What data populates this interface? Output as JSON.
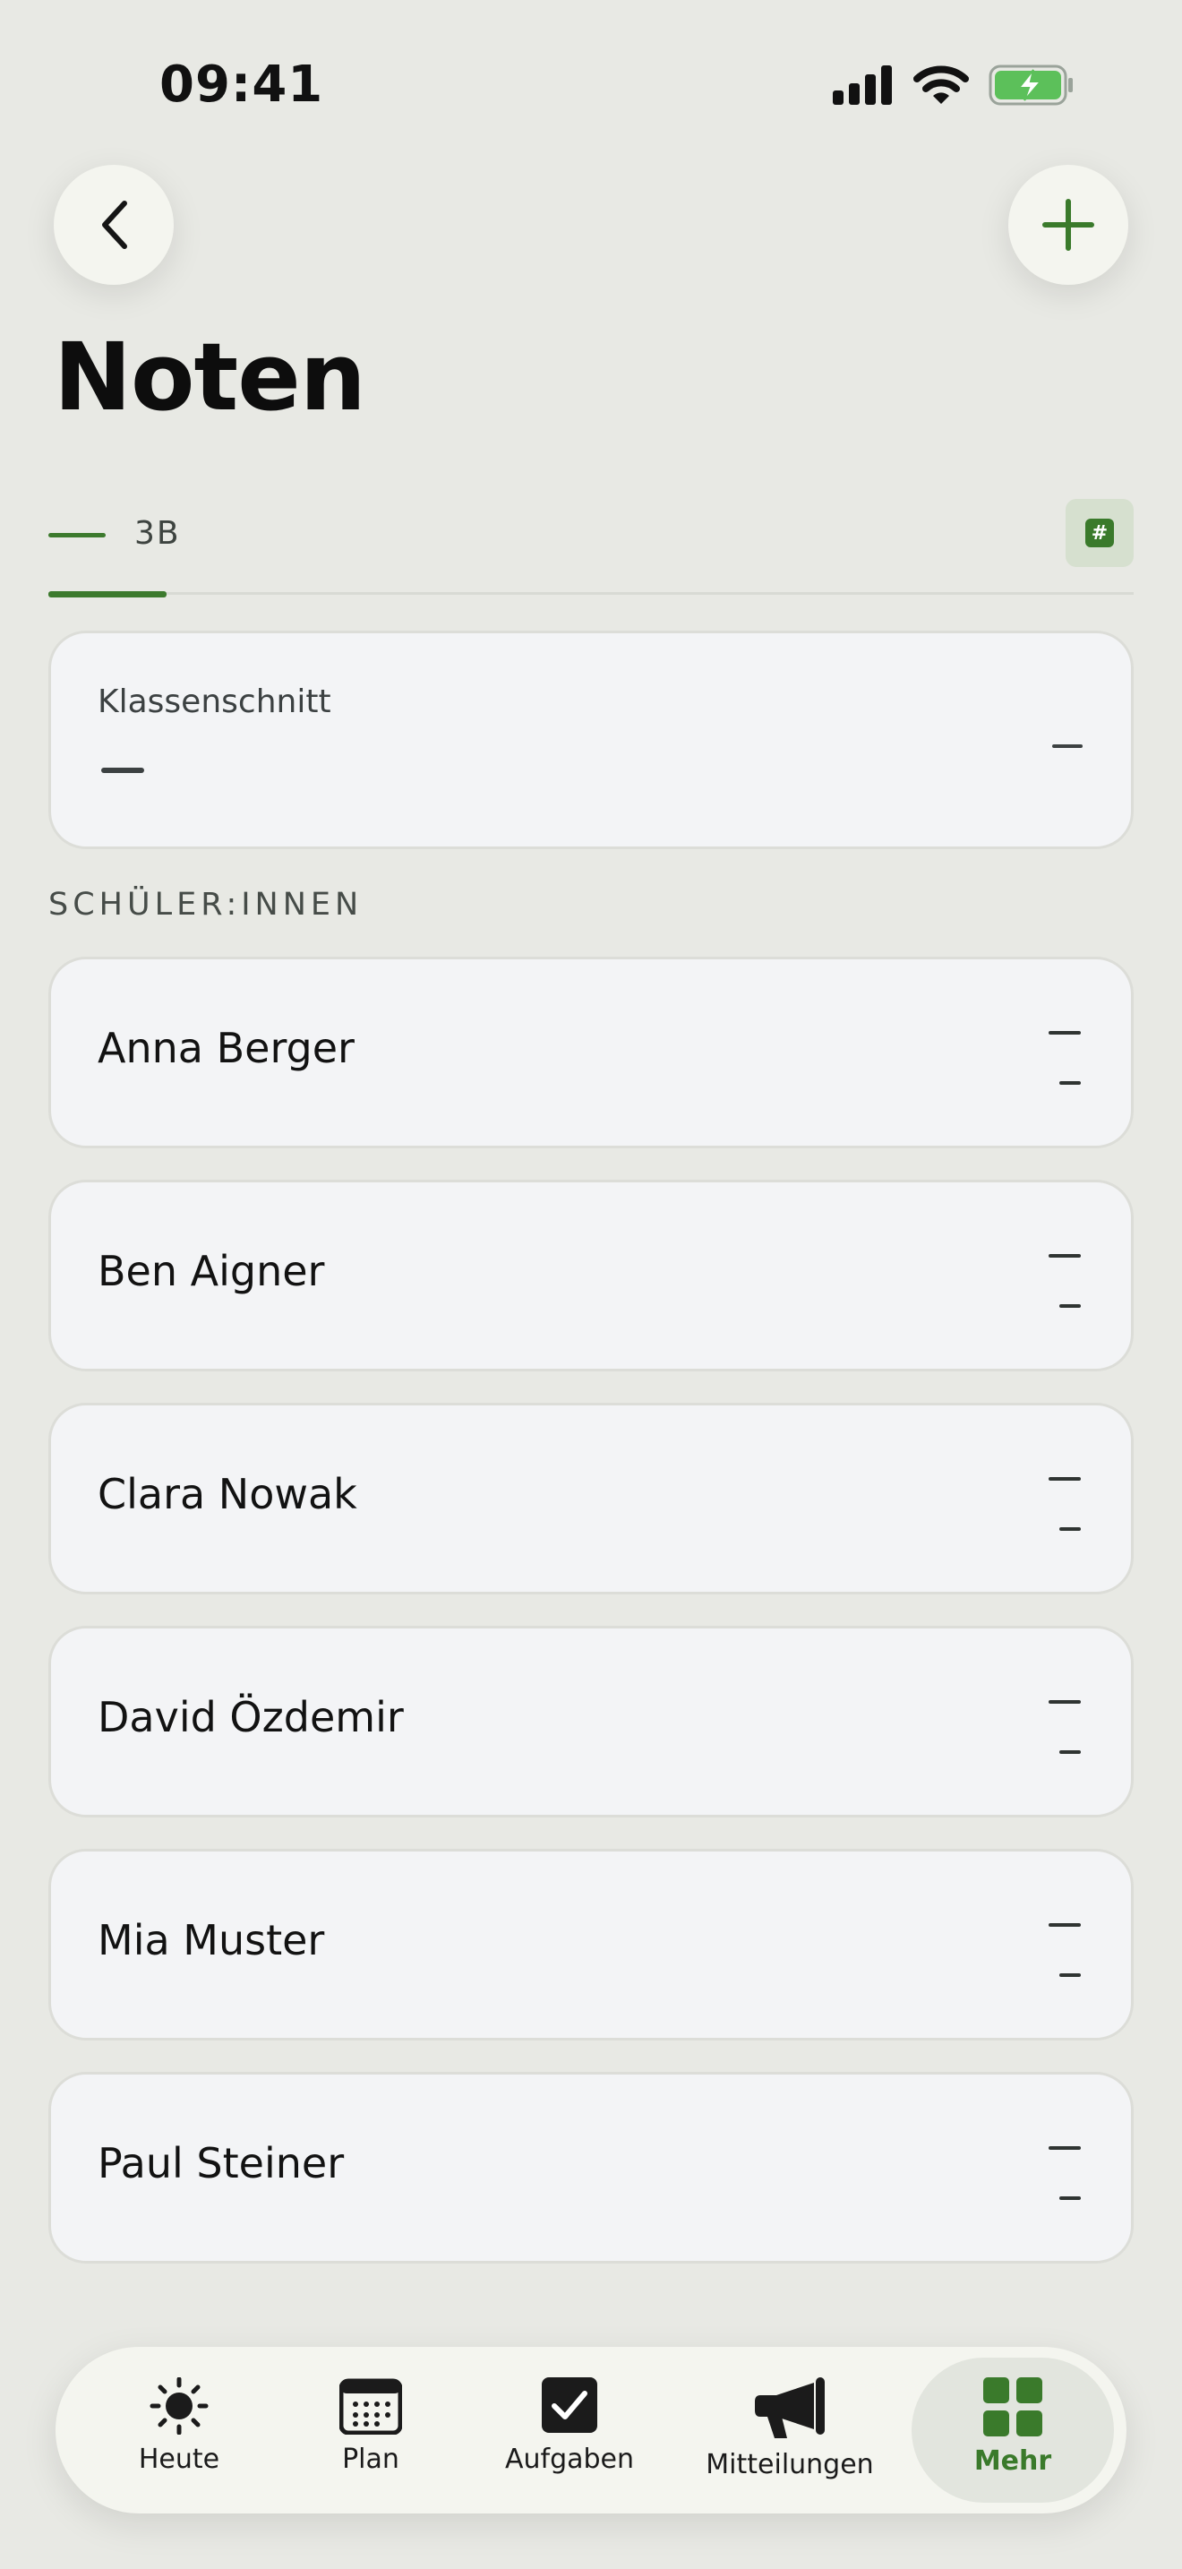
{
  "status_bar": {
    "time": "09:41"
  },
  "header": {
    "title": "Noten"
  },
  "tabs": {
    "active_label": "3B",
    "hash_symbol": "#"
  },
  "average_card": {
    "label": "Klassenschnitt"
  },
  "students_section": {
    "label": "SCHÜLER:INNEN"
  },
  "students": [
    {
      "name": "Anna Berger"
    },
    {
      "name": "Ben Aigner"
    },
    {
      "name": "Clara Nowak"
    },
    {
      "name": "David Özdemir"
    },
    {
      "name": "Mia Muster"
    },
    {
      "name": "Paul Steiner"
    }
  ],
  "bottom_nav": {
    "items": [
      {
        "label": "Heute",
        "icon": "sun-icon"
      },
      {
        "label": "Plan",
        "icon": "calendar-icon"
      },
      {
        "label": "Aufgaben",
        "icon": "checkbox-icon"
      },
      {
        "label": "Mitteilungen",
        "icon": "megaphone-icon"
      },
      {
        "label": "Mehr",
        "icon": "grid-icon",
        "active": true
      }
    ]
  },
  "colors": {
    "accent": "#3a7a2b",
    "background": "#e8e9e4",
    "card": "#f3f4f6",
    "battery": "#5cc05a"
  }
}
